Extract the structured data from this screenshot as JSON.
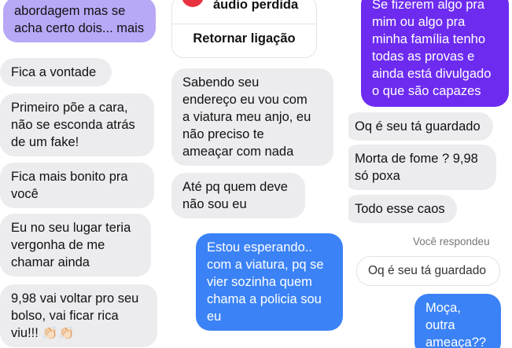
{
  "left": {
    "top_partial": "abordagem mas se\nacha certo dois... mais",
    "messages": [
      "Fica a vontade",
      "Primeiro põe a cara,\nnão se esconda atrás\nde um fake!",
      "Fica mais bonito pra\nvocê",
      "Eu no seu lugar teria\nvergonha de me\nchamar ainda",
      "9,98 vai voltar pro seu\nbolso, vai ficar rica\nviu!!! 👏🏻👏🏻"
    ]
  },
  "middle": {
    "call_title": "áudio perdida",
    "call_button": "Retornar ligação",
    "messages": [
      "Sabendo seu\nendereço eu vou com\na viatura meu anjo, eu\nnão preciso te\nameaçar com nada",
      "Até pq quem deve\nnão sou eu"
    ],
    "sent": "Estou esperando..\ncom a viatura, pq se\nvier sozinha quem\nchama a policia sou\neu"
  },
  "right": {
    "top_partial": "Se fizerem algo pra\nmim ou algo pra\nminha família tenho\ntodas as provas e\nainda está divulgado\no que são capazes",
    "messages": [
      "Oq é seu tá guardado",
      "Morta de fome ? 9,98\nsó poxa",
      "Todo esse caos"
    ],
    "reply_label": "Você respondeu",
    "reply_quote": "Oq é seu tá guardado",
    "sent": "Moça, outra\nameaça??"
  },
  "colors": {
    "received": "#ececef",
    "sent_blue": "#3b82f6",
    "sent_purple": "#6d2bf0",
    "sent_purple_light": "#b8a8f6"
  }
}
